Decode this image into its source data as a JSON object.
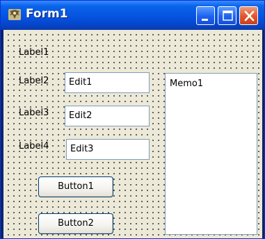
{
  "window": {
    "title": "Form1",
    "controls": [
      "minimize-icon",
      "maximize-icon",
      "close-icon"
    ]
  },
  "form": {
    "labels": [
      "Label1",
      "Label2",
      "Label3",
      "Label4"
    ],
    "edits": [
      "Edit1",
      "Edit2",
      "Edit3"
    ],
    "memo": "Memo1",
    "buttons": [
      "Button1",
      "Button2"
    ]
  },
  "colors": {
    "titlebar": "#0553e0",
    "client": "#ece9d8",
    "close_button": "#e0552a",
    "field_border": "#7f9db9"
  }
}
